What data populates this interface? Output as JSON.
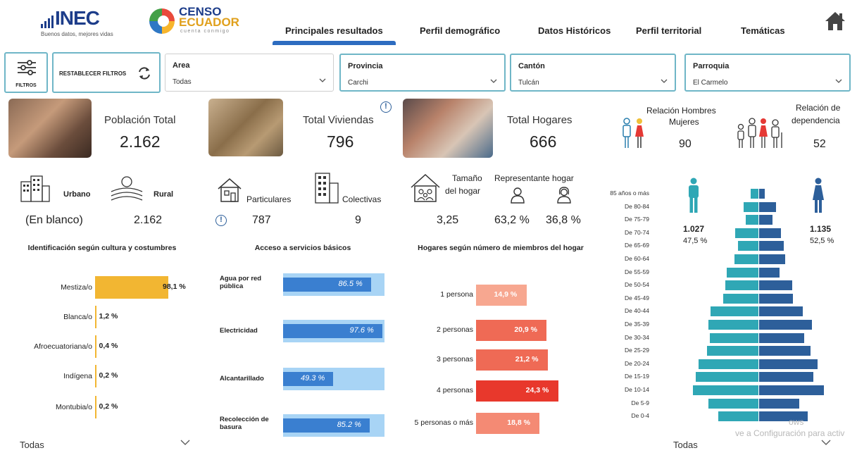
{
  "header": {
    "inec_logo": "INEC",
    "inec_tagline": "Buenos datos, mejores vidas",
    "censo_line1": "CENSO",
    "censo_line2": "ECUADOR",
    "censo_tagline": "cuenta conmigo",
    "tabs": [
      {
        "label": "Principales resultados",
        "active": true
      },
      {
        "label": "Perfil demográfico",
        "active": false
      },
      {
        "label": "Datos Históricos",
        "active": false
      },
      {
        "label": "Perfil territorial",
        "active": false
      },
      {
        "label": "Temáticas",
        "active": false
      }
    ],
    "home_icon": "home-icon"
  },
  "filters": {
    "filtros_label": "FILTROS",
    "reset_label": "RESTABLECER FILTROS",
    "area": {
      "label": "Area",
      "value": "Todas"
    },
    "provincia": {
      "label": "Provincia",
      "value": "Carchi"
    },
    "canton": {
      "label": "Cantón",
      "value": "Tulcán"
    },
    "parroquia": {
      "label": "Parroquia",
      "value": "El Carmelo"
    }
  },
  "kpis": {
    "poblacion": {
      "label": "Población Total",
      "value": "2.162"
    },
    "viviendas": {
      "label": "Total Viviendas",
      "value": "796"
    },
    "hogares": {
      "label": "Total Hogares",
      "value": "666"
    },
    "relacion_hm": {
      "label_line1": "Relación Hombres",
      "label_line2": "Mujeres",
      "value": "90"
    },
    "dependencia": {
      "label_line1": "Relación de",
      "label_line2": "dependencia",
      "value": "52"
    }
  },
  "area_split": {
    "urbano_label": "Urbano",
    "rural_label": "Rural",
    "urbano_value": "(En blanco)",
    "rural_value": "2.162"
  },
  "viviendas_split": {
    "particulares_label": "Particulares",
    "colectivas_label": "Colectivas",
    "particulares_value": "787",
    "colectivas_value": "9"
  },
  "hogar_info": {
    "tamano_line1": "Tamaño",
    "tamano_line2": "del hogar",
    "representante_label": "Representante hogar",
    "tamano_value": "3,25",
    "hombre_value": "63,2 %",
    "mujer_value": "36,8 %"
  },
  "cultura": {
    "title": "Identificación según cultura y costumbres",
    "color": "#f2b632",
    "items": [
      {
        "label": "Mestiza/o",
        "value": 98.1,
        "text": "98,1 %"
      },
      {
        "label": "Blanca/o",
        "value": 1.2,
        "text": "1,2 %"
      },
      {
        "label": "Afroecuatoriana/o",
        "value": 0.4,
        "text": "0,4 %"
      },
      {
        "label": "Indígena",
        "value": 0.2,
        "text": "0,2 %"
      },
      {
        "label": "Montubia/o",
        "value": 0.2,
        "text": "0,2 %"
      }
    ],
    "filter_value": "Todas"
  },
  "servicios": {
    "title": "Acceso a servicios básicos",
    "color": "#3a7fd0",
    "bg_color": "#a8d4f5",
    "items": [
      {
        "label_line1": "Agua por red",
        "label_line2": "pública",
        "value": 86.5,
        "text": "86.5 %"
      },
      {
        "label_line1": "Electricidad",
        "label_line2": "",
        "value": 97.6,
        "text": "97.6 %"
      },
      {
        "label_line1": "Alcantarillado",
        "label_line2": "",
        "value": 49.3,
        "text": "49.3 %"
      },
      {
        "label_line1": "Recolección de",
        "label_line2": "basura",
        "value": 85.2,
        "text": "85.2 %"
      }
    ]
  },
  "miembros": {
    "title": "Hogares según número de miembros del hogar",
    "items": [
      {
        "label": "1 persona",
        "value": 14.9,
        "text": "14,9 %",
        "color": "#f7a790"
      },
      {
        "label": "2 personas",
        "value": 20.9,
        "text": "20,9 %",
        "color": "#ef6a55"
      },
      {
        "label": "3 personas",
        "value": 21.2,
        "text": "21,2 %",
        "color": "#ef6a55"
      },
      {
        "label": "4 personas",
        "value": 24.3,
        "text": "24,3 %",
        "color": "#e8382c"
      },
      {
        "label": "5 personas o más",
        "value": 18.8,
        "text": "18,8 %",
        "color": "#f48a74"
      }
    ]
  },
  "piramide": {
    "hombres_count": "1.027",
    "hombres_pct": "47,5 %",
    "mujeres_count": "1.135",
    "mujeres_pct": "52,5 %",
    "male_color": "#2fa7b5",
    "female_color": "#2d5f9a",
    "ages": [
      "85 años o más",
      "De 80-84",
      "De 75-79",
      "De 70-74",
      "De 65-69",
      "De 60-64",
      "De 55-59",
      "De 50-54",
      "De 45-49",
      "De 40-44",
      "De 35-39",
      "De 30-34",
      "De 25-29",
      "De 20-24",
      "De 15-19",
      "De 10-14",
      "De 5-9",
      "De 0-4"
    ],
    "male": [
      0.11,
      0.2,
      0.17,
      0.32,
      0.28,
      0.33,
      0.43,
      0.45,
      0.48,
      0.65,
      0.68,
      0.66,
      0.7,
      0.82,
      0.86,
      0.89,
      0.68,
      0.55
    ],
    "female": [
      0.08,
      0.23,
      0.18,
      0.3,
      0.34,
      0.36,
      0.28,
      0.45,
      0.46,
      0.6,
      0.72,
      0.62,
      0.7,
      0.8,
      0.74,
      0.88,
      0.55,
      0.66
    ],
    "filter_value": "Todas",
    "watermark_line1": "ows",
    "watermark_line2": "ve a Configuración para activ"
  }
}
